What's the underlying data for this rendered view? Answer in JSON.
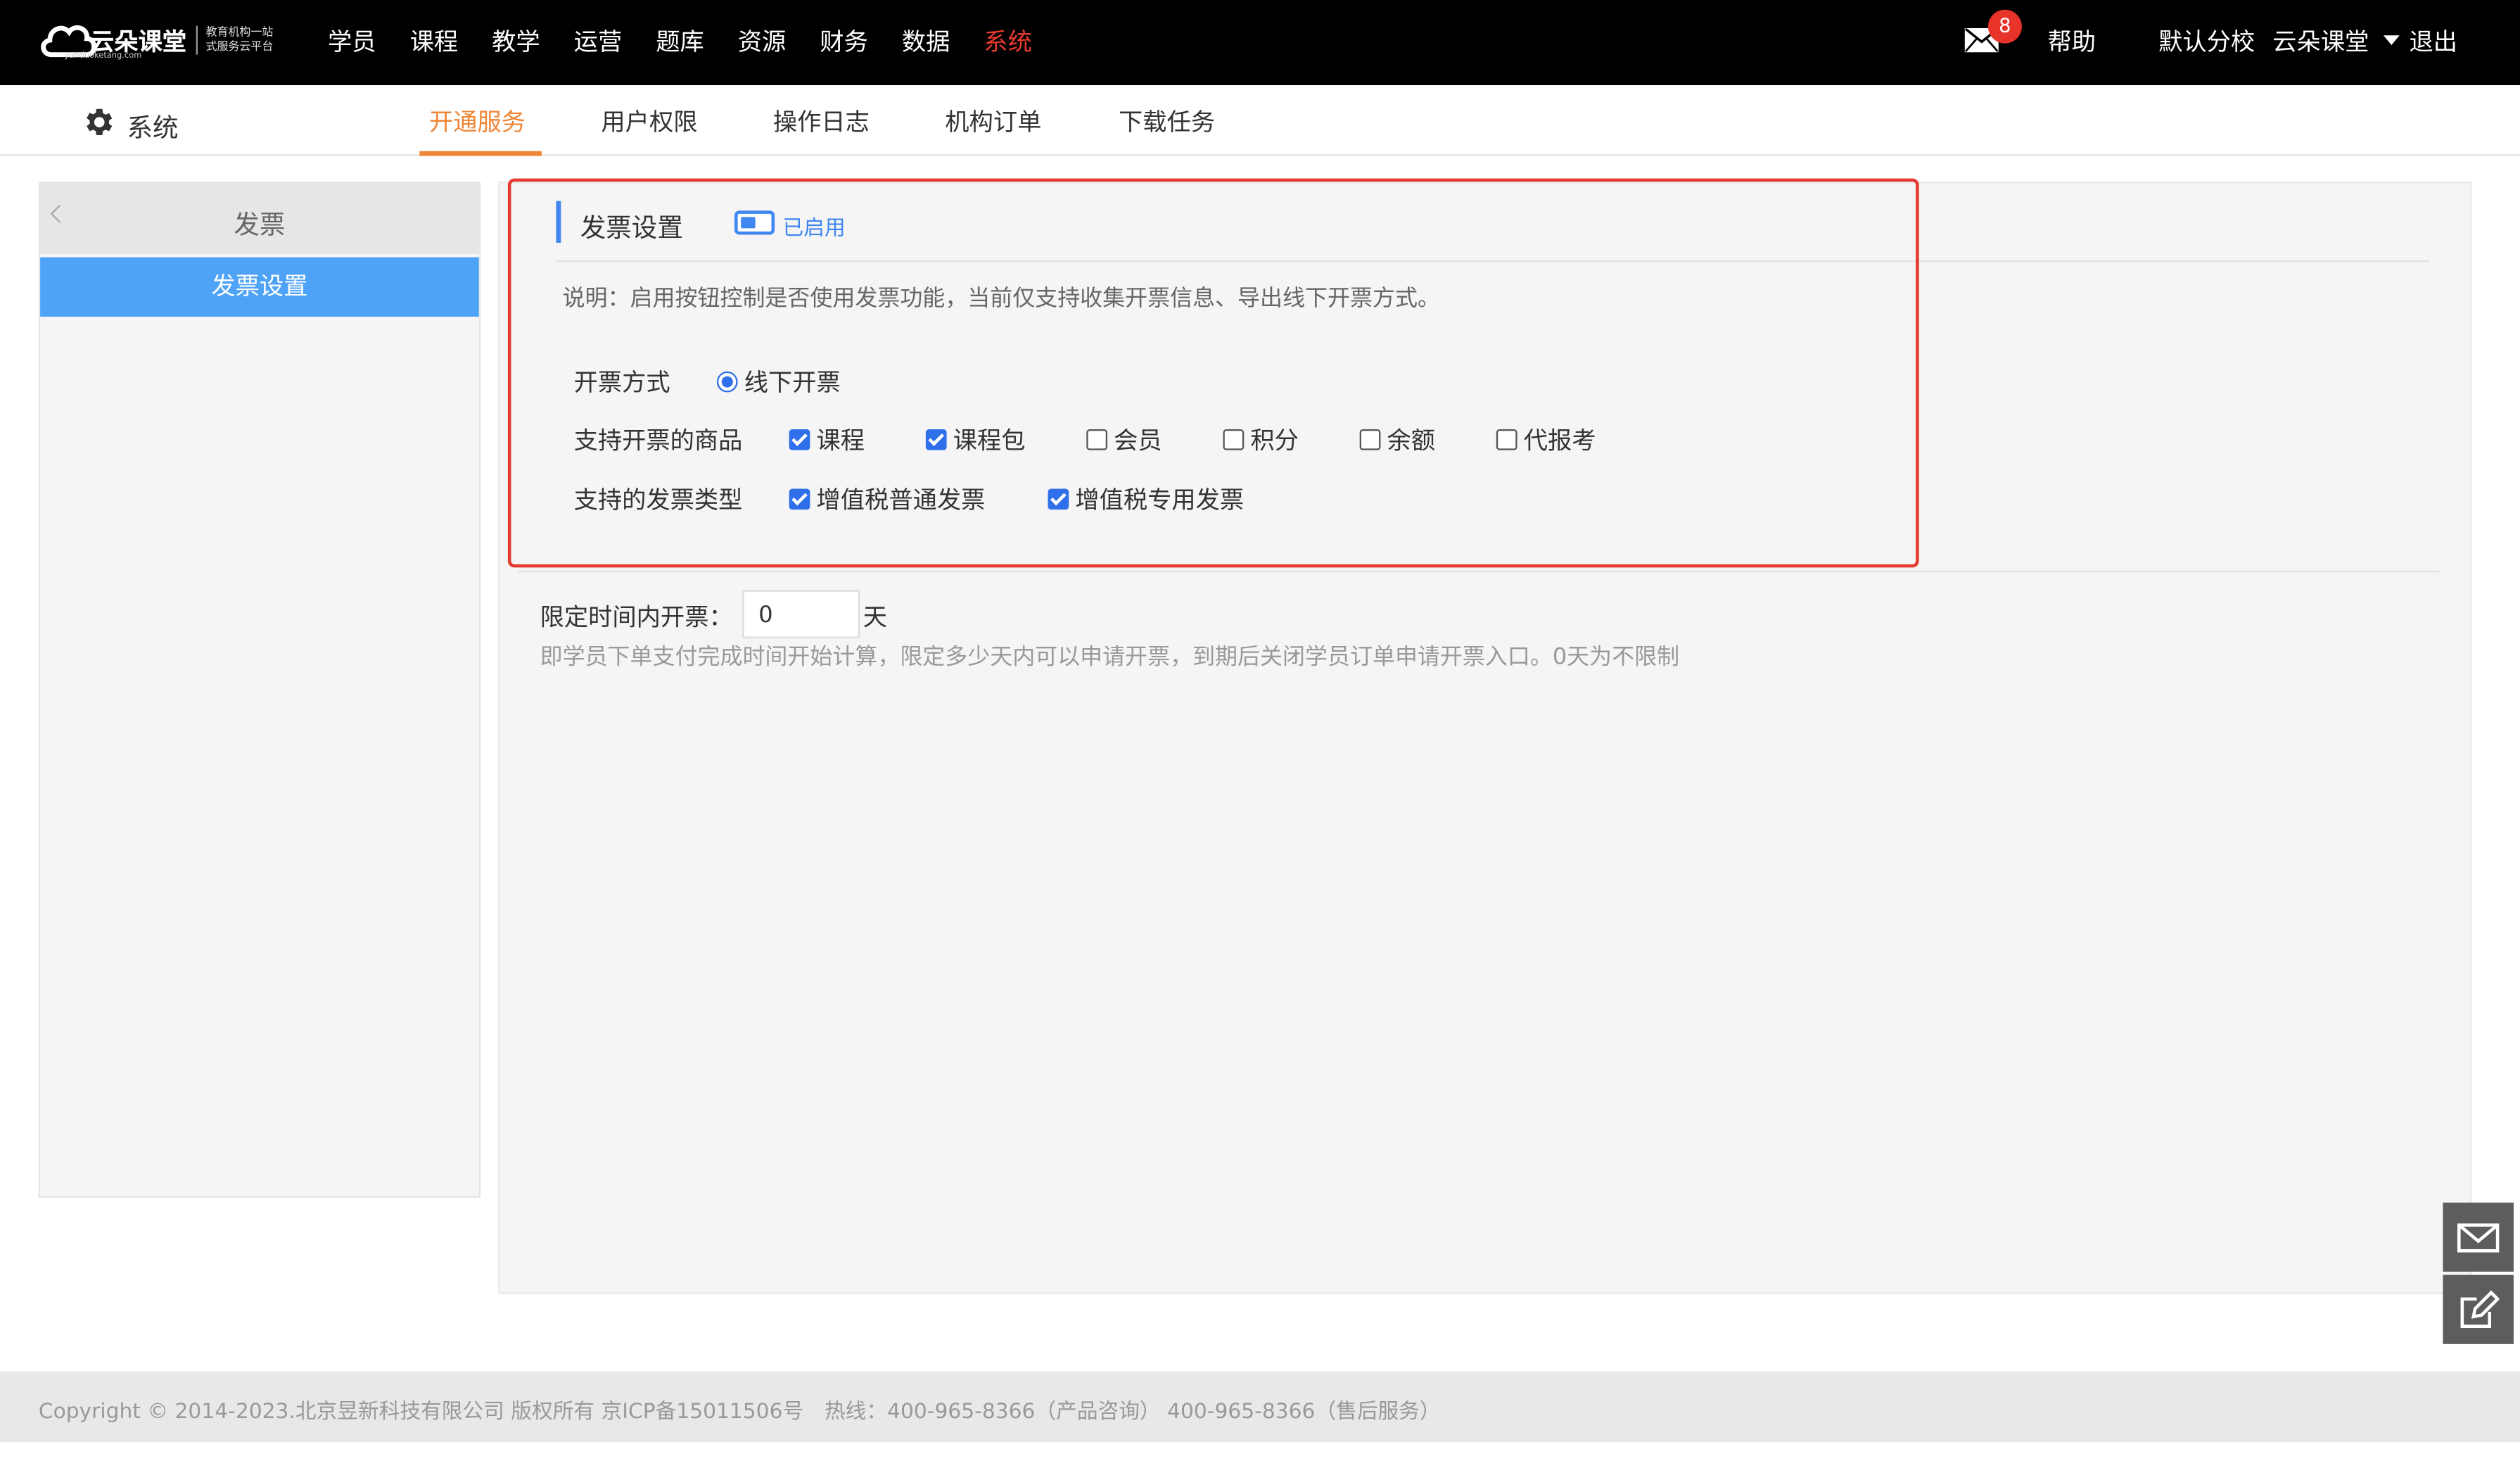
{
  "colors": {
    "nav_active": "#e63b2e",
    "tab_active": "#f08537",
    "sidebar_active": "#4fa3f7",
    "accent_blue": "#3f86f0",
    "highlight_border": "#e53a30"
  },
  "logo": {
    "name": "云朵课堂",
    "tagline_1": "教育机构一站",
    "tagline_2": "式服务云平台",
    "url": "yunduoketang.com"
  },
  "top_nav": [
    "学员",
    "课程",
    "教学",
    "运营",
    "题库",
    "资源",
    "财务",
    "数据",
    "系统"
  ],
  "header": {
    "mail_badge": "8",
    "help": "帮助",
    "branch": "默认分校",
    "school": "云朵课堂",
    "logout": "退出"
  },
  "subnav": {
    "title": "系统",
    "tabs": [
      "开通服务",
      "用户权限",
      "操作日志",
      "机构订单",
      "下载任务"
    ]
  },
  "sidebar": {
    "title": "发票",
    "items": [
      "发票设置"
    ]
  },
  "invoice": {
    "title": "发票设置",
    "toggle_label": "已启用",
    "description": "说明：启用按钮控制是否使用发票功能，当前仅支持收集开票信息、导出线下开票方式。",
    "method_label": "开票方式",
    "method_option": "线下开票",
    "goods_label": "支持开票的商品",
    "goods": [
      {
        "label": "课程",
        "checked": true
      },
      {
        "label": "课程包",
        "checked": true
      },
      {
        "label": "会员",
        "checked": false
      },
      {
        "label": "积分",
        "checked": false
      },
      {
        "label": "余额",
        "checked": false
      },
      {
        "label": "代报考",
        "checked": false
      }
    ],
    "types_label": "支持的发票类型",
    "types": [
      {
        "label": "增值税普通发票",
        "checked": true
      },
      {
        "label": "增值税专用发票",
        "checked": true
      }
    ]
  },
  "limit": {
    "label": "限定时间内开票：",
    "value": "0",
    "unit": "天",
    "help": "即学员下单支付完成时间开始计算，限定多少天内可以申请开票，到期后关闭学员订单申请开票入口。0天为不限制"
  },
  "footer": {
    "copyright": "Copyright © 2014-2023.北京昱新科技有限公司 版权所有 京ICP备15011506号",
    "hotline": "热线：400-965-8366（产品咨询） 400-965-8366（售后服务）"
  }
}
